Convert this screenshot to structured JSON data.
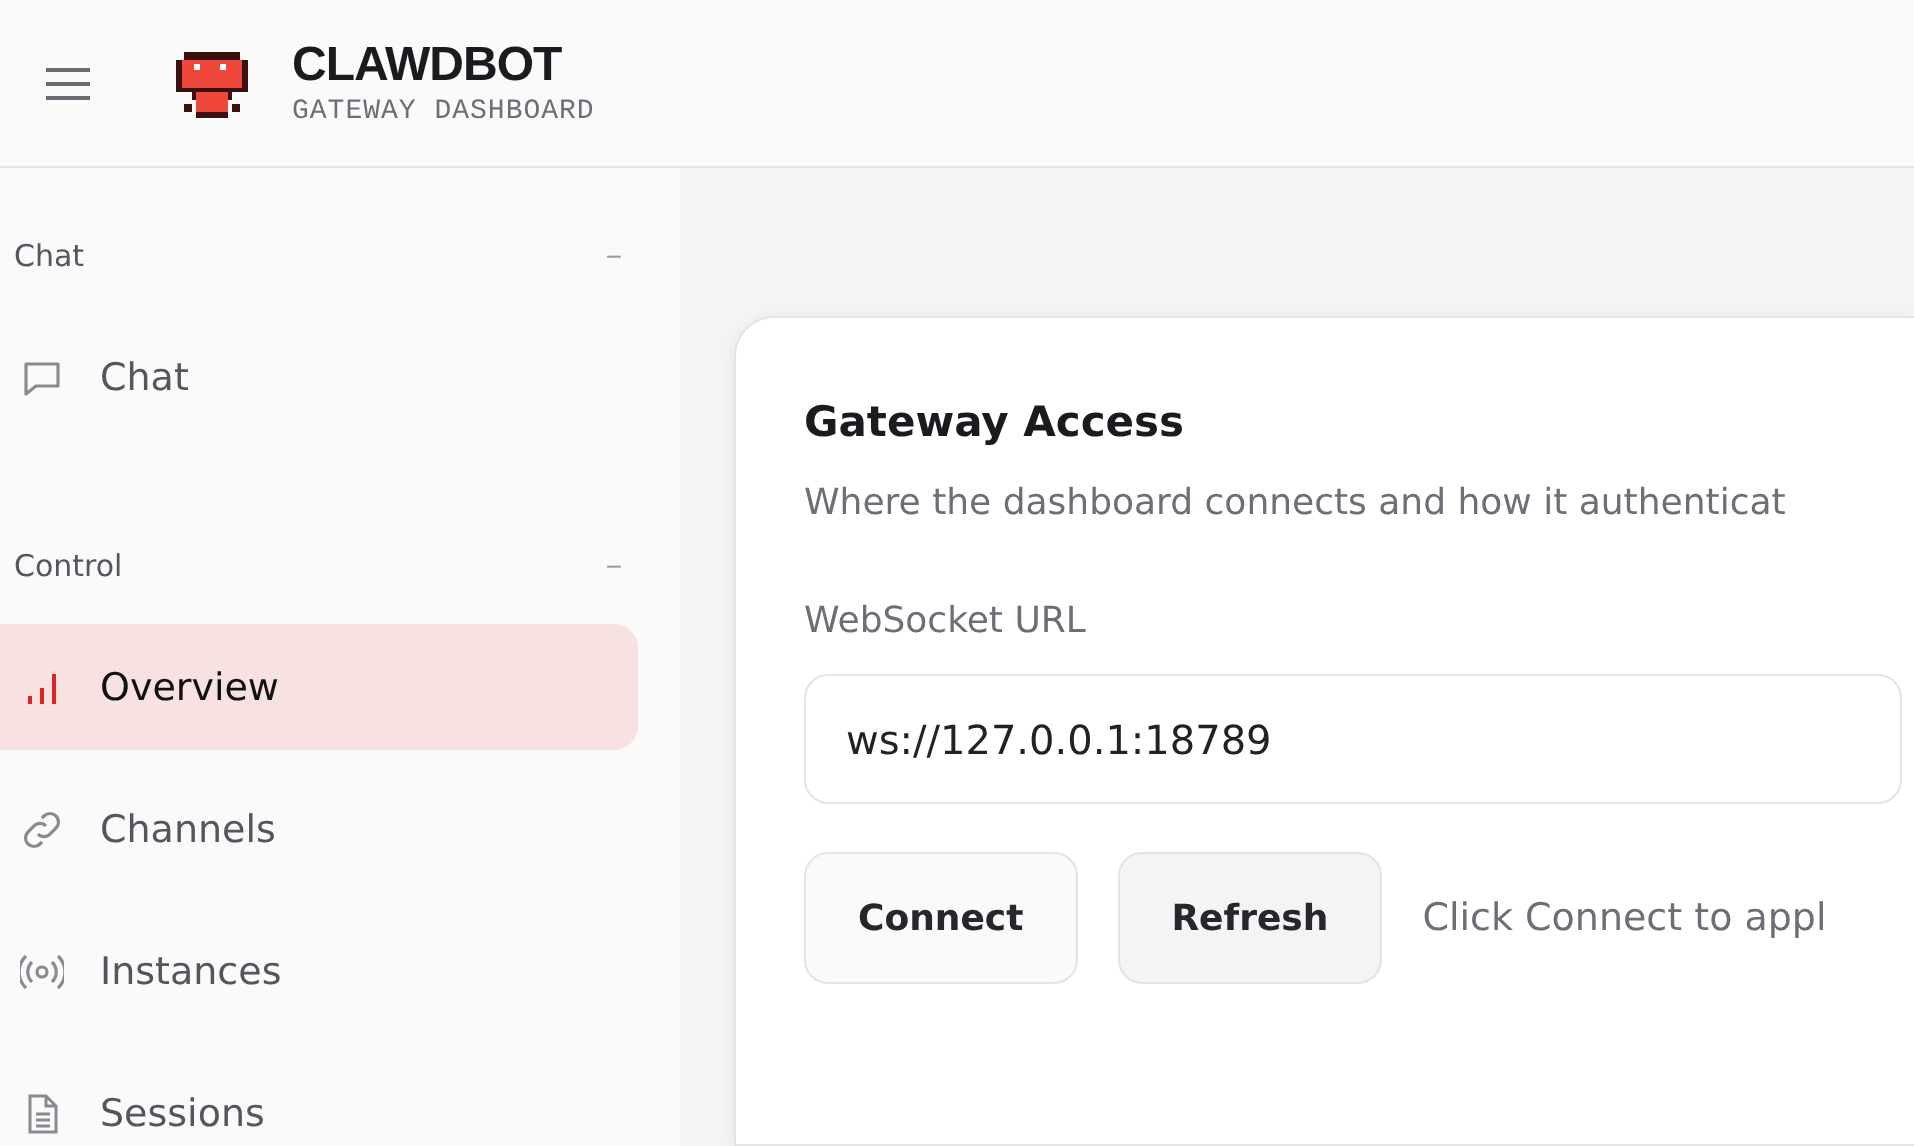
{
  "header": {
    "title": "CLAWDBOT",
    "subtitle": "GATEWAY DASHBOARD"
  },
  "sidebar": {
    "groups": [
      {
        "label": "Chat",
        "toggle": "−",
        "items": [
          {
            "label": "Chat",
            "selected": false
          }
        ]
      },
      {
        "label": "Control",
        "toggle": "−",
        "items": [
          {
            "label": "Overview",
            "selected": true
          },
          {
            "label": "Channels",
            "selected": false
          },
          {
            "label": "Instances",
            "selected": false
          },
          {
            "label": "Sessions",
            "selected": false
          }
        ]
      }
    ]
  },
  "card": {
    "title": "Gateway Access",
    "description": "Where the dashboard connects and how it authenticat",
    "field": {
      "label": "WebSocket URL",
      "value": "ws://127.0.0.1:18789"
    },
    "buttons": [
      {
        "label": "Connect",
        "kind": "plain"
      },
      {
        "label": "Refresh",
        "kind": "muted"
      }
    ],
    "hint": "Click Connect to appl"
  }
}
